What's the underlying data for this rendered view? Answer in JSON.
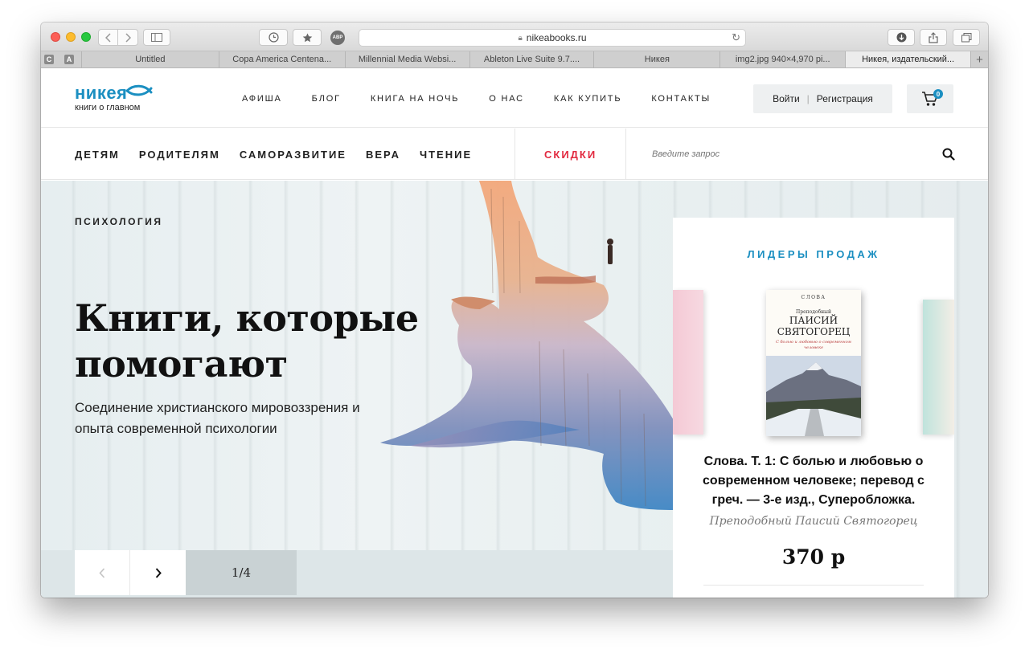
{
  "browser": {
    "url": "nikeabooks.ru",
    "pinned_tabs": [
      "C",
      "A"
    ],
    "tabs": [
      {
        "label": "Untitled",
        "active": false
      },
      {
        "label": "Copa America Centena...",
        "active": false
      },
      {
        "label": "Millennial Media Websi...",
        "active": false
      },
      {
        "label": "Ableton Live Suite 9.7....",
        "active": false
      },
      {
        "label": "Никея",
        "active": false
      },
      {
        "label": "img2.jpg 940×4,970 pi...",
        "active": false
      },
      {
        "label": "Никея, издательский...",
        "active": true
      }
    ],
    "adblock_label": "ABP",
    "new_tab_label": "+"
  },
  "header": {
    "logo_text": "никея",
    "logo_subtitle": "книги о главном",
    "nav": [
      "АФИША",
      "БЛОГ",
      "КНИГА НА НОЧЬ",
      "О НАС",
      "КАК КУПИТЬ",
      "КОНТАКТЫ"
    ],
    "login_label": "Войти",
    "register_label": "Регистрация",
    "cart_count": "0"
  },
  "categories": {
    "items": [
      "ДЕТЯМ",
      "РОДИТЕЛЯМ",
      "САМОРАЗВИТИЕ",
      "ВЕРА",
      "ЧТЕНИЕ"
    ],
    "sale_label": "СКИДКИ",
    "search_placeholder": "Введите запрос"
  },
  "hero": {
    "category": "ПСИХОЛОГИЯ",
    "title": "Книги, которые помогают",
    "subtitle": "Соединение христианского мировоззрения и опыта современной психологии",
    "counter": "1/4"
  },
  "bestsellers": {
    "heading": "ЛИДЕРЫ ПРОДАЖ",
    "book": {
      "cover_publisher": "СЛОВА",
      "cover_prefix": "Преподобный",
      "cover_name": "ПАИСИЙ СВЯТОГОРЕЦ",
      "cover_desc": "С болью и любовью о современном человеке",
      "title": "Слова. Т. 1: С болью и любовью о современном человеке; перевод с греч. — 3-е изд., Суперобложка.",
      "author": "Преподобный Паисий Святогорец",
      "price": "370 р"
    }
  },
  "colors": {
    "brand": "#1b8fc1",
    "sale": "#e2293f"
  }
}
